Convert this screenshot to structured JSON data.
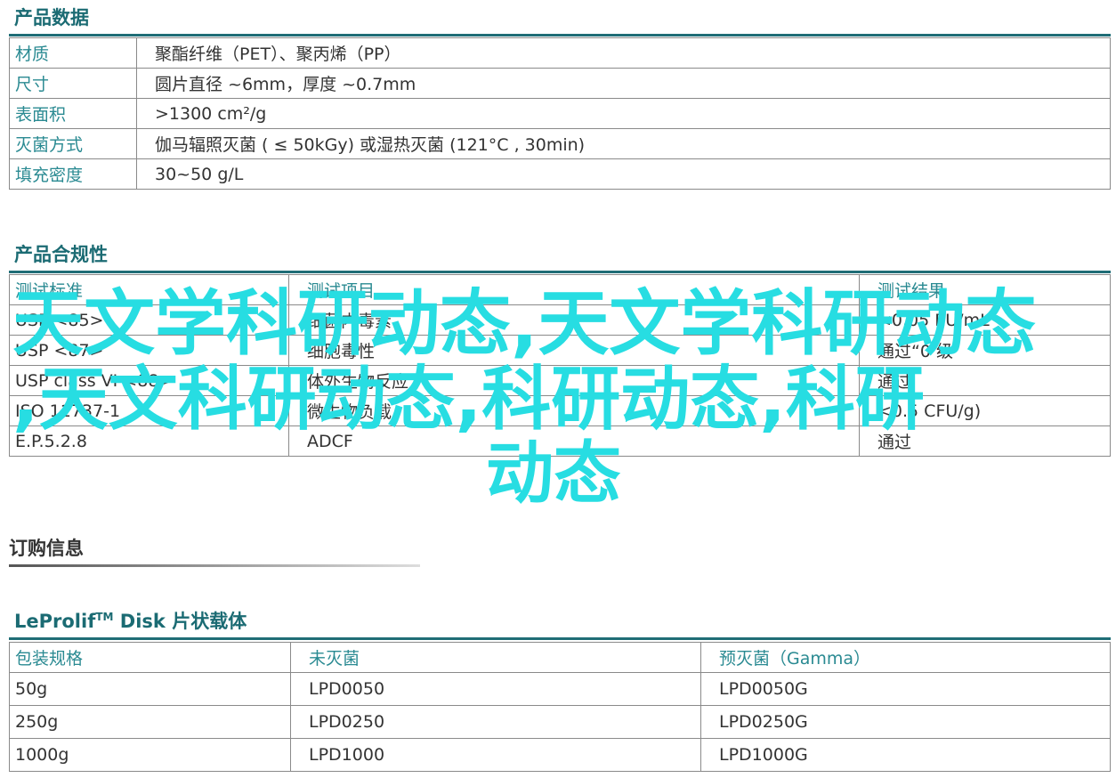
{
  "product_data": {
    "title": "产品数据",
    "rows": [
      {
        "key": "材质",
        "value": "聚酯纤维（PET）、聚丙烯（PP）"
      },
      {
        "key": "尺寸",
        "value": "圆片直径 ~6mm，厚度 ~0.7mm"
      },
      {
        "key": "表面积",
        "value": ">1300 cm²/g"
      },
      {
        "key": "灭菌方式",
        "value": "伽马辐照灭菌 ( ≤ 50kGy) 或湿热灭菌 (121°C , 30min)"
      },
      {
        "key": "填充密度",
        "value": "30~50 g/L"
      }
    ]
  },
  "compliance": {
    "title": "产品合规性",
    "headers": [
      "测试标准",
      "测试项目",
      "测试结果"
    ],
    "rows": [
      [
        "USP <85>",
        "细菌内毒素",
        "<0.05 EU/mL"
      ],
      [
        "USP <87>",
        "细胞毒性",
        "通过“0 级"
      ],
      [
        "USP class VI <88>",
        "体外生物反应",
        "通过"
      ],
      [
        "ISO 11737-1",
        "微生物负载",
        "<0.5 CFU/g)"
      ],
      [
        "E.P.5.2.8",
        "ADCF",
        "通过"
      ]
    ]
  },
  "order_info": {
    "title": "订购信息"
  },
  "disk": {
    "title_brand": "LeProlif",
    "title_tm": "TM",
    "title_rest": " Disk 片状载体",
    "headers": [
      "包装规格",
      "未灭菌",
      "预灭菌（Gamma）"
    ],
    "rows": [
      [
        "50g",
        "LPD0050",
        "LPD0050G"
      ],
      [
        "250g",
        "LPD0250",
        "LPD0250G"
      ],
      [
        "1000g",
        "LPD1000",
        "LPD1000G"
      ]
    ]
  },
  "overlay": {
    "line1": "天文学科研动态,天文学科研动态",
    "line2": ",天文科研动态,科研动态,科研",
    "line3": "动态"
  },
  "colors": {
    "teal_title": "#1b6b73",
    "teal_key": "#2a8a92",
    "overlay": "#27dde2"
  }
}
